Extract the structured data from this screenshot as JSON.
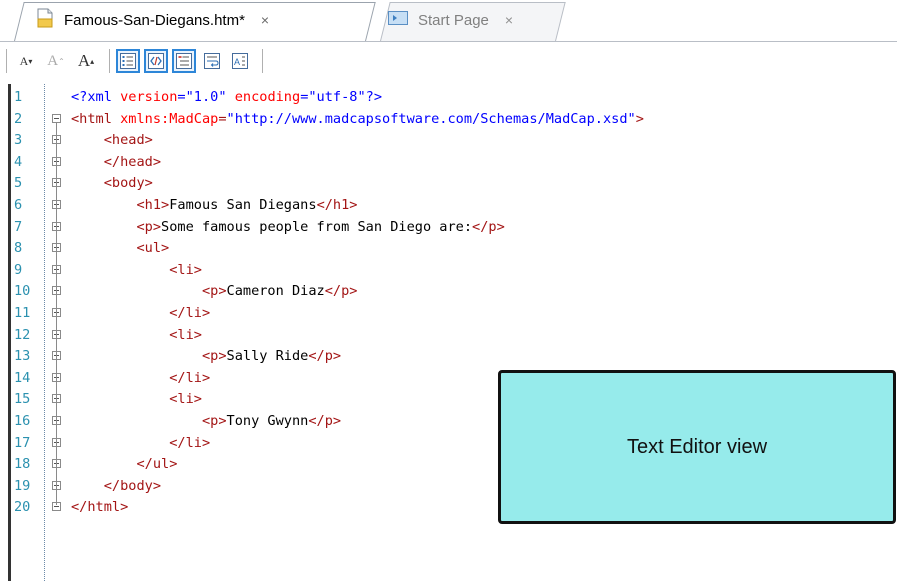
{
  "tabs": [
    {
      "label": "Famous-San-Diegans.htm*",
      "close": "×",
      "icon": "html-file-icon",
      "active": true
    },
    {
      "label": "Start Page",
      "close": "×",
      "icon": "start-page-icon",
      "active": false
    }
  ],
  "toolbar": {
    "font_decrease": "A",
    "font_reset": "A",
    "font_increase": "A",
    "buttons": [
      "line-numbers-icon",
      "show-tags-icon",
      "structure-bar-icon",
      "word-wrap-icon",
      "auto-format-icon"
    ]
  },
  "editor": {
    "lines": [
      {
        "n": "1",
        "indent": "",
        "parts": [
          {
            "c": "pi",
            "t": "<?xml "
          },
          {
            "c": "attr",
            "t": "version"
          },
          {
            "c": "pi",
            "t": "="
          },
          {
            "c": "val",
            "t": "\"1.0\""
          },
          {
            "c": "pi",
            "t": " "
          },
          {
            "c": "attr",
            "t": "encoding"
          },
          {
            "c": "pi",
            "t": "="
          },
          {
            "c": "val",
            "t": "\"utf-8\""
          },
          {
            "c": "pi",
            "t": "?>"
          }
        ]
      },
      {
        "n": "2",
        "indent": "",
        "parts": [
          {
            "c": "tag",
            "t": "<html "
          },
          {
            "c": "attr",
            "t": "xmlns:MadCap"
          },
          {
            "c": "tag",
            "t": "="
          },
          {
            "c": "val",
            "t": "\"http://www.madcapsoftware.com/Schemas/MadCap.xsd\""
          },
          {
            "c": "tag",
            "t": ">"
          }
        ]
      },
      {
        "n": "3",
        "indent": "    ",
        "parts": [
          {
            "c": "tag",
            "t": "<head>"
          }
        ]
      },
      {
        "n": "4",
        "indent": "    ",
        "parts": [
          {
            "c": "tag",
            "t": "</head>"
          }
        ]
      },
      {
        "n": "5",
        "indent": "    ",
        "parts": [
          {
            "c": "tag",
            "t": "<body>"
          }
        ]
      },
      {
        "n": "6",
        "indent": "        ",
        "parts": [
          {
            "c": "tag",
            "t": "<h1>"
          },
          {
            "c": "txt",
            "t": "Famous San Diegans"
          },
          {
            "c": "tag",
            "t": "</h1>"
          }
        ]
      },
      {
        "n": "7",
        "indent": "        ",
        "parts": [
          {
            "c": "tag",
            "t": "<p>"
          },
          {
            "c": "txt",
            "t": "Some famous people from San Diego are:"
          },
          {
            "c": "tag",
            "t": "</p>"
          }
        ]
      },
      {
        "n": "8",
        "indent": "        ",
        "parts": [
          {
            "c": "tag",
            "t": "<ul>"
          }
        ]
      },
      {
        "n": "9",
        "indent": "            ",
        "parts": [
          {
            "c": "tag",
            "t": "<li>"
          }
        ]
      },
      {
        "n": "10",
        "indent": "                ",
        "parts": [
          {
            "c": "tag",
            "t": "<p>"
          },
          {
            "c": "txt",
            "t": "Cameron Diaz"
          },
          {
            "c": "tag",
            "t": "</p>"
          }
        ]
      },
      {
        "n": "11",
        "indent": "            ",
        "parts": [
          {
            "c": "tag",
            "t": "</li>"
          }
        ]
      },
      {
        "n": "12",
        "indent": "            ",
        "parts": [
          {
            "c": "tag",
            "t": "<li>"
          }
        ]
      },
      {
        "n": "13",
        "indent": "                ",
        "parts": [
          {
            "c": "tag",
            "t": "<p>"
          },
          {
            "c": "txt",
            "t": "Sally Ride"
          },
          {
            "c": "tag",
            "t": "</p>"
          }
        ]
      },
      {
        "n": "14",
        "indent": "            ",
        "parts": [
          {
            "c": "tag",
            "t": "</li>"
          }
        ]
      },
      {
        "n": "15",
        "indent": "            ",
        "parts": [
          {
            "c": "tag",
            "t": "<li>"
          }
        ]
      },
      {
        "n": "16",
        "indent": "                ",
        "parts": [
          {
            "c": "tag",
            "t": "<p>"
          },
          {
            "c": "txt",
            "t": "Tony Gwynn"
          },
          {
            "c": "tag",
            "t": "</p>"
          }
        ]
      },
      {
        "n": "17",
        "indent": "            ",
        "parts": [
          {
            "c": "tag",
            "t": "</li>"
          }
        ]
      },
      {
        "n": "18",
        "indent": "        ",
        "parts": [
          {
            "c": "tag",
            "t": "</ul>"
          }
        ]
      },
      {
        "n": "19",
        "indent": "    ",
        "parts": [
          {
            "c": "tag",
            "t": "</body>"
          }
        ]
      },
      {
        "n": "20",
        "indent": "",
        "parts": [
          {
            "c": "tag",
            "t": "</html>"
          }
        ]
      }
    ]
  },
  "callout": {
    "label": "Text Editor view"
  },
  "colors": {
    "callout_bg": "#96ebeb",
    "tag": "#a31515",
    "attr": "#ff0000",
    "value": "#0000ff",
    "line_number": "#2b91af"
  }
}
